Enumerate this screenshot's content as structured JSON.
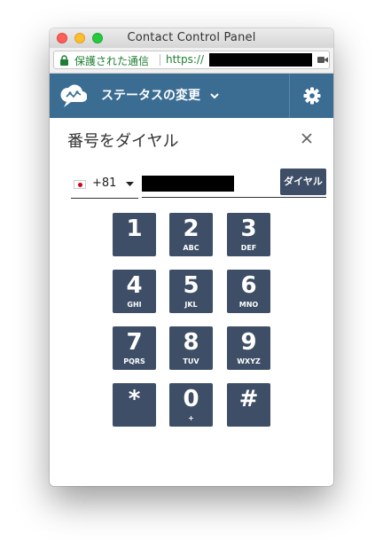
{
  "window": {
    "title": "Contact Control Panel"
  },
  "urlbar": {
    "secure_label": "保護された通信",
    "protocol": "https://"
  },
  "header": {
    "status_label": "ステータスの変更"
  },
  "panel": {
    "title": "番号をダイヤル"
  },
  "dialer": {
    "country_code": "+81",
    "country": "Japan",
    "dial_label": "ダイヤル",
    "keys": [
      {
        "digit": "1",
        "sub": ""
      },
      {
        "digit": "2",
        "sub": "ABC"
      },
      {
        "digit": "3",
        "sub": "DEF"
      },
      {
        "digit": "4",
        "sub": "GHI"
      },
      {
        "digit": "5",
        "sub": "JKL"
      },
      {
        "digit": "6",
        "sub": "MNO"
      },
      {
        "digit": "7",
        "sub": "PQRS"
      },
      {
        "digit": "8",
        "sub": "TUV"
      },
      {
        "digit": "9",
        "sub": "WXYZ"
      },
      {
        "digit": "*",
        "sub": ""
      },
      {
        "digit": "0",
        "sub": "+"
      },
      {
        "digit": "#",
        "sub": ""
      }
    ]
  },
  "colors": {
    "header_bg": "#3b6d93",
    "key_bg": "#3d4e66",
    "secure_green": "#1e7e34"
  },
  "icons": [
    "lock-icon",
    "camera-icon",
    "logo-icon",
    "chevron-down-icon",
    "gear-icon",
    "close-icon",
    "japan-flag-icon",
    "caret-down-icon"
  ]
}
